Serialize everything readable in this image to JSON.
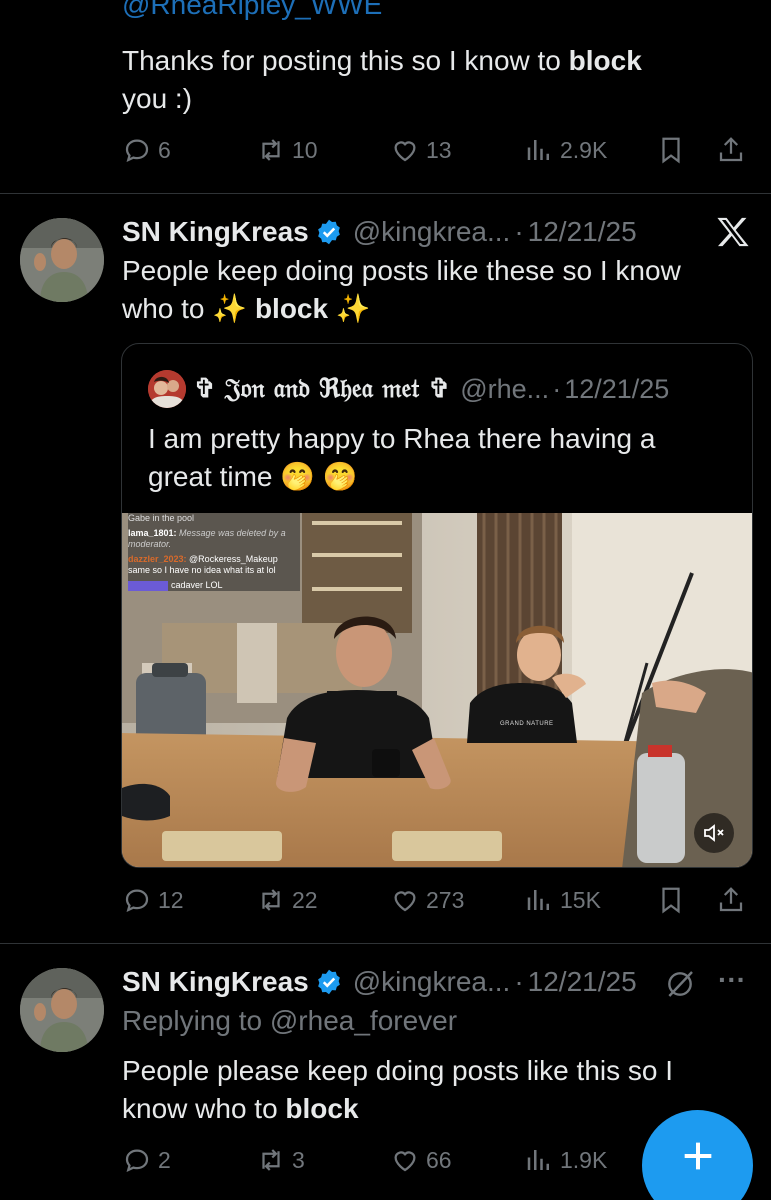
{
  "top_tweet": {
    "mention": "@RheaRipley_WWE",
    "text_before": "Thanks for posting this so I know to ",
    "text_bold": "block",
    "text_after_line2": "you :)",
    "replies": "6",
    "retweets": "10",
    "likes": "13",
    "views": "2.9K"
  },
  "tweet2": {
    "name": "SN KingKreas",
    "handle": "@kingkrea...",
    "dot": "·",
    "date": "12/21/25",
    "text_line1": "People keep doing posts like these so I know",
    "text_line2_prefix": "who to ",
    "text_bold": "block",
    "sparkle": "✨",
    "replies": "12",
    "retweets": "22",
    "likes": "273",
    "views": "15K",
    "quote": {
      "name": "✞ 𝔍𝔬𝔫 𝔞𝔫𝔡 ℜ𝔥𝔢𝔞 𝔪𝔢𝔱 ✞",
      "handle": "@rhe...",
      "dot": "·",
      "date": "12/21/25",
      "text_line1": "I am pretty happy to Rhea there having a",
      "text_line2": "great time",
      "emoji": "🤭 🤭",
      "chat": {
        "line0": "Gabe in the pool",
        "user1": "lama_1801:",
        "msg1": " Message was deleted by a moderator.",
        "user2": "dazzler_2023:",
        "msg2": " @Rockeress_Makeup same so I have no idea what its at lol",
        "msg3": " cadaver LOL"
      },
      "shirt_text": "GRAND NATURE"
    }
  },
  "tweet3": {
    "name": "SN KingKreas",
    "handle": "@kingkrea...",
    "dot": "·",
    "date": "12/21/25",
    "replying_prefix": "Replying to ",
    "replying_handle": "@rhea_forever",
    "text_line1": "People please keep doing posts like this so I",
    "text_line2_prefix": "know who to ",
    "text_bold": "block",
    "replies": "2",
    "retweets": "3",
    "likes": "66",
    "views": "1.9K",
    "more": "···"
  },
  "colors": {
    "accent": "#1d9bf0",
    "muted": "#71767b",
    "border": "#2f3336",
    "background": "#000000"
  }
}
